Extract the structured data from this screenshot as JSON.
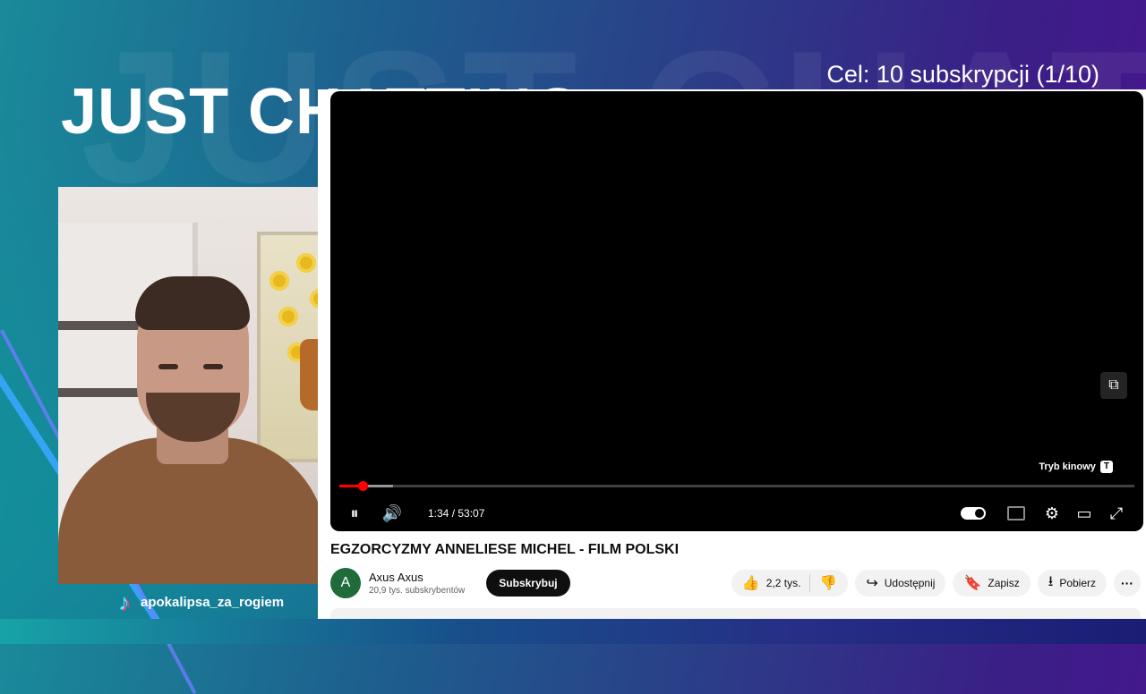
{
  "overlay": {
    "title": "JUST CHATTING",
    "goal": "Cel: 10 subskrypcji (1/10)",
    "tiktok_handle": "apokalipsa_za_rogiem"
  },
  "player": {
    "tooltip_label": "Tryb kinowy",
    "tooltip_key": "T",
    "time": "1:34 / 53:07",
    "progress_fraction": 0.0295,
    "buffer_fraction": 0.068,
    "accent_color": "#ff0000"
  },
  "video": {
    "title": "EGZORCYZMY ANNELIESE MICHEL - FILM POLSKI",
    "channel_initial": "A",
    "channel_name": "Axus Axus",
    "channel_subs": "20,9 tys. subskrybentów",
    "subscribe_label": "Subskrybuj",
    "like_count": "2,2 tys.",
    "share_label": "Udostępnij",
    "save_label": "Zapisz",
    "download_label": "Pobierz",
    "more_label": "···"
  },
  "icons": {
    "pause": "⏸",
    "volume": "🔊",
    "settings": "⚙",
    "theater": "▭",
    "fullscreen": "⤢",
    "miniplayer": "⧉",
    "like": "👍",
    "dislike": "👎",
    "share": "↪",
    "save": "🔖",
    "download": "⭳",
    "tiktok": "♪"
  }
}
